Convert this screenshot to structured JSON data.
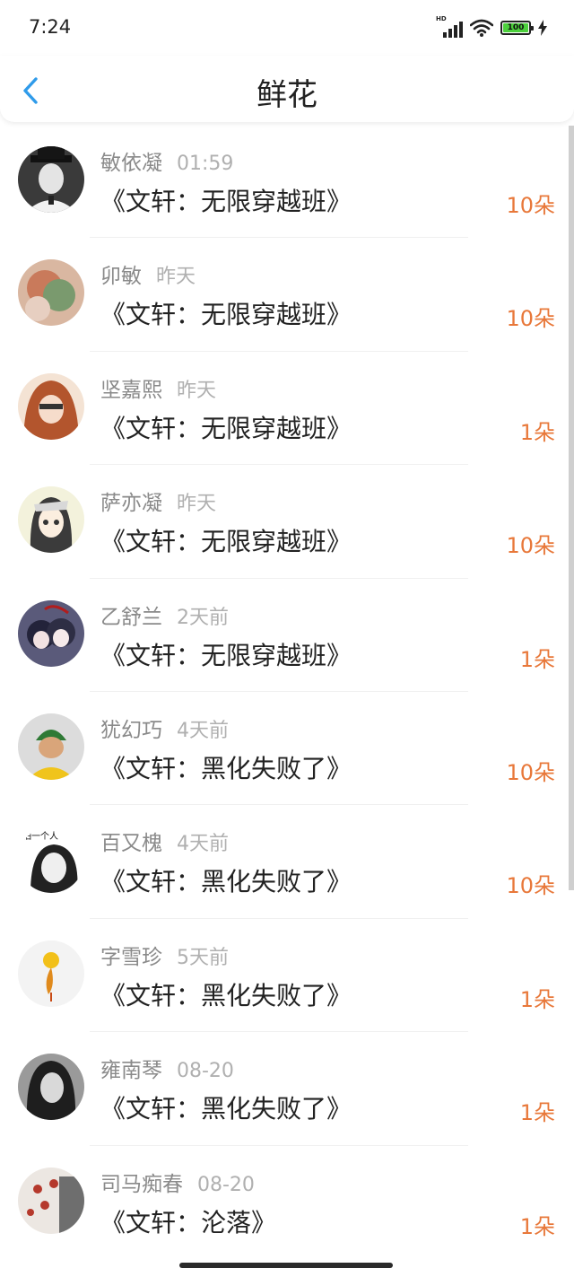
{
  "status_bar": {
    "time": "7:24",
    "network": "HD",
    "battery": "100"
  },
  "header": {
    "title": "鲜花",
    "accent_color": "#2f9bea"
  },
  "flower_color": "#e8783a",
  "items": [
    {
      "name": "敏依凝",
      "time": "01:59",
      "book": "《文轩：无限穿越班》",
      "flowers": "10朵"
    },
    {
      "name": "卯敏",
      "time": "昨天",
      "book": "《文轩：无限穿越班》",
      "flowers": "10朵"
    },
    {
      "name": "坚嘉熙",
      "time": "昨天",
      "book": "《文轩：无限穿越班》",
      "flowers": "1朵"
    },
    {
      "name": "萨亦凝",
      "time": "昨天",
      "book": "《文轩：无限穿越班》",
      "flowers": "10朵"
    },
    {
      "name": "乙舒兰",
      "time": "2天前",
      "book": "《文轩：无限穿越班》",
      "flowers": "1朵"
    },
    {
      "name": "犹幻巧",
      "time": "4天前",
      "book": "《文轩：黑化失败了》",
      "flowers": "10朵"
    },
    {
      "name": "百又槐",
      "time": "4天前",
      "book": "《文轩：黑化失败了》",
      "flowers": "10朵",
      "avatar_caption": "怕一个人"
    },
    {
      "name": "字雪珍",
      "time": "5天前",
      "book": "《文轩：黑化失败了》",
      "flowers": "1朵"
    },
    {
      "name": "雍南琴",
      "time": "08-20",
      "book": "《文轩：黑化失败了》",
      "flowers": "1朵"
    },
    {
      "name": "司马痴春",
      "time": "08-20",
      "book": "《文轩：沦落》",
      "flowers": "1朵"
    }
  ]
}
